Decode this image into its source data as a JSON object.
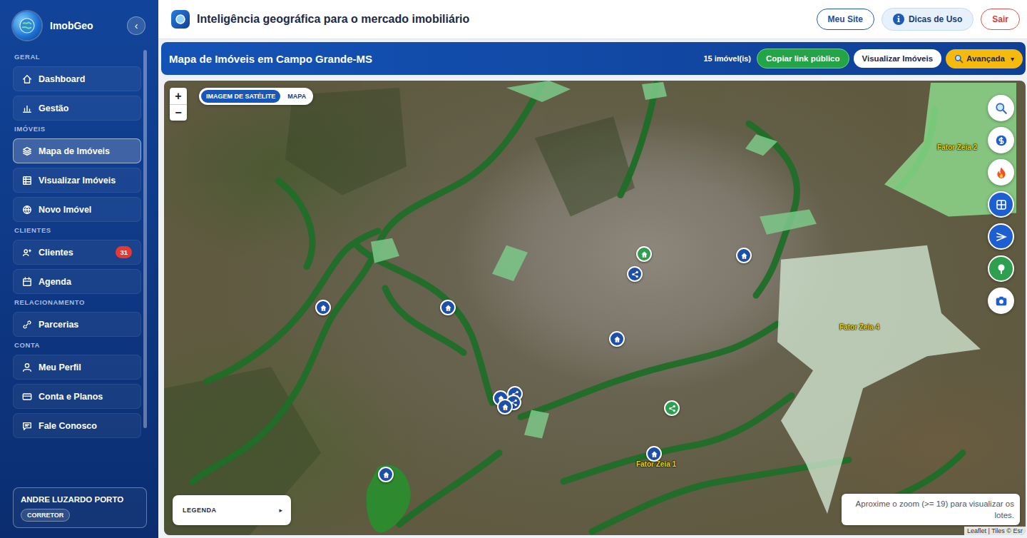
{
  "app": {
    "name": "ImobGeo",
    "collapse": "‹"
  },
  "sidebar": {
    "sections": [
      {
        "title": "GERAL",
        "items": [
          {
            "label": "Dashboard",
            "selected": false
          },
          {
            "label": "Gestão",
            "selected": false
          }
        ]
      },
      {
        "title": "IMÓVEIS",
        "items": [
          {
            "label": "Mapa de Imóveis",
            "selected": true
          },
          {
            "label": "Visualizar Imóveis",
            "selected": false
          },
          {
            "label": "Novo Imóvel",
            "selected": false
          }
        ]
      },
      {
        "title": "CLIENTES",
        "items": [
          {
            "label": "Clientes",
            "selected": false,
            "badge": "31"
          },
          {
            "label": "Agenda",
            "selected": false
          }
        ]
      },
      {
        "title": "RELACIONAMENTO",
        "items": [
          {
            "label": "Parcerias",
            "selected": false
          }
        ]
      },
      {
        "title": "CONTA",
        "items": [
          {
            "label": "Meu Perfil",
            "selected": false
          },
          {
            "label": "Conta e Planos",
            "selected": false
          },
          {
            "label": "Fale Conosco",
            "selected": false
          }
        ]
      }
    ]
  },
  "user": {
    "name": "ANDRE LUZARDO PORTO",
    "role": "CORRETOR"
  },
  "header": {
    "title": "Inteligência geográfica para o mercado imobiliário",
    "buttons": [
      {
        "label": "Meu Site",
        "kind": "outline"
      },
      {
        "label": "Dicas de Uso",
        "kind": "info",
        "icon": "i"
      },
      {
        "label": "Sair",
        "kind": "danger"
      }
    ]
  },
  "titlebar": {
    "title": "Mapa de Imóveis em Campo Grande-MS",
    "count": "15 imóvel(is)",
    "buttons": [
      {
        "label": "Copiar link público",
        "kind": "green"
      },
      {
        "label": "Visualizar Imóveis",
        "kind": "white"
      },
      {
        "label": "Avançada",
        "kind": "yellow",
        "caret": "▾"
      }
    ]
  },
  "map": {
    "layers": [
      {
        "label": "IMAGEM DE SATÉLITE",
        "selected": true
      },
      {
        "label": "MAPA",
        "selected": false
      }
    ],
    "zoom": [
      "+",
      "−"
    ],
    "zones": [
      "Fator Zeia 2",
      "Fator Zeia 4",
      "Fator Zeia 1"
    ],
    "pins": [
      {
        "kind": "house",
        "color": "#2e9e4f"
      },
      {
        "kind": "share",
        "color": "#1d4fa8"
      },
      {
        "kind": "house",
        "color": "#1d4fa8"
      },
      {
        "kind": "house",
        "color": "#1d4fa8"
      },
      {
        "kind": "house",
        "color": "#1d4fa8"
      },
      {
        "kind": "house",
        "color": "#1d4fa8"
      },
      {
        "kind": "house",
        "color": "#1d4fa8"
      },
      {
        "kind": "share",
        "color": "#1d4fa8"
      },
      {
        "kind": "share",
        "color": "#1d4fa8"
      },
      {
        "kind": "house",
        "color": "#1d4fa8"
      },
      {
        "kind": "share",
        "color": "#2e9e4f"
      },
      {
        "kind": "house",
        "color": "#1d4fa8"
      },
      {
        "kind": "house",
        "color": "#1d4fa8"
      }
    ],
    "tools": [
      {
        "kind": "search",
        "color": "#ffffff"
      },
      {
        "kind": "coin",
        "color": "#ffffff"
      },
      {
        "kind": "fire",
        "color": "#ffffff"
      },
      {
        "kind": "grid",
        "color": "#1d5fd0"
      },
      {
        "kind": "route",
        "color": "#1d5fd0"
      },
      {
        "kind": "tree",
        "color": "#2e9e4f"
      },
      {
        "kind": "camera",
        "color": "#ffffff"
      }
    ],
    "legend": "LEGENDA",
    "legend_arrow": "▸",
    "hint": "Aproxime o zoom (>= 19) para visualizar os lotes.",
    "attribution": "Leaflet | Tiles © Esr"
  }
}
